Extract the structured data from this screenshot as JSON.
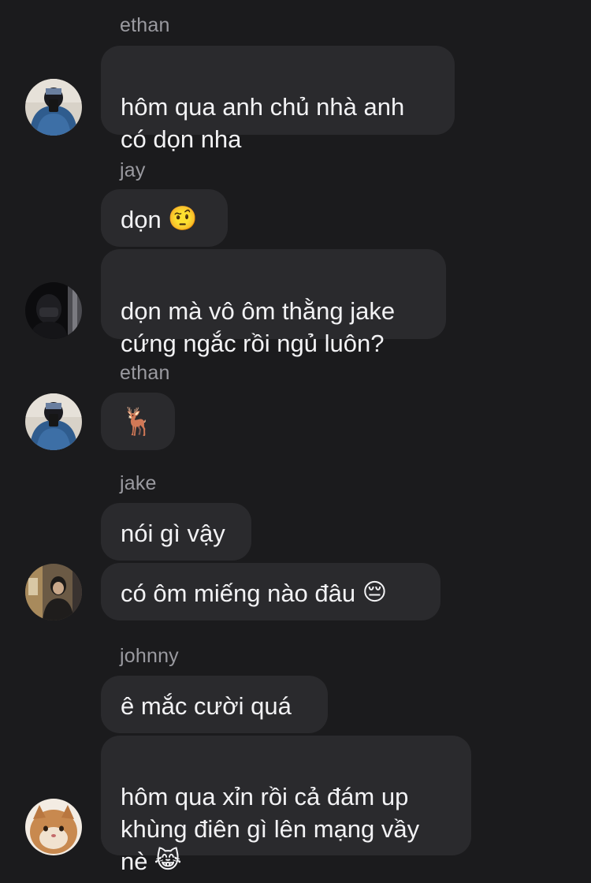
{
  "messages": [
    {
      "sender": "ethan",
      "text": "hôm qua anh chủ nhà anh\ncó dọn nha"
    },
    {
      "sender": "jay",
      "text": "dọn",
      "emoji": "🤨"
    },
    {
      "text": "dọn mà vô ôm thằng jake\ncứng ngắc rồi ngủ luôn?"
    },
    {
      "sender": "ethan",
      "emoji": "🦌"
    },
    {
      "sender": "jake",
      "text": "nói gì vậy"
    },
    {
      "text": "có ôm miếng nào đâu",
      "emoji": "😔"
    },
    {
      "sender": "johnny",
      "text": "ê mắc cười quá"
    },
    {
      "text": "hôm qua xỉn rồi cả đám up\nkhùng điên gì lên mạng vầy\nnè",
      "emoji": "😹"
    }
  ],
  "colors": {
    "background": "#1b1b1d",
    "bubble": "#2a2a2d",
    "sender_name": "#9a9aa0",
    "text": "#f2f2f4"
  },
  "icons": {
    "avatar_ethan": "ethan-avatar",
    "avatar_jay": "jay-avatar",
    "avatar_jake": "jake-avatar",
    "avatar_johnny": "johnny-avatar"
  }
}
